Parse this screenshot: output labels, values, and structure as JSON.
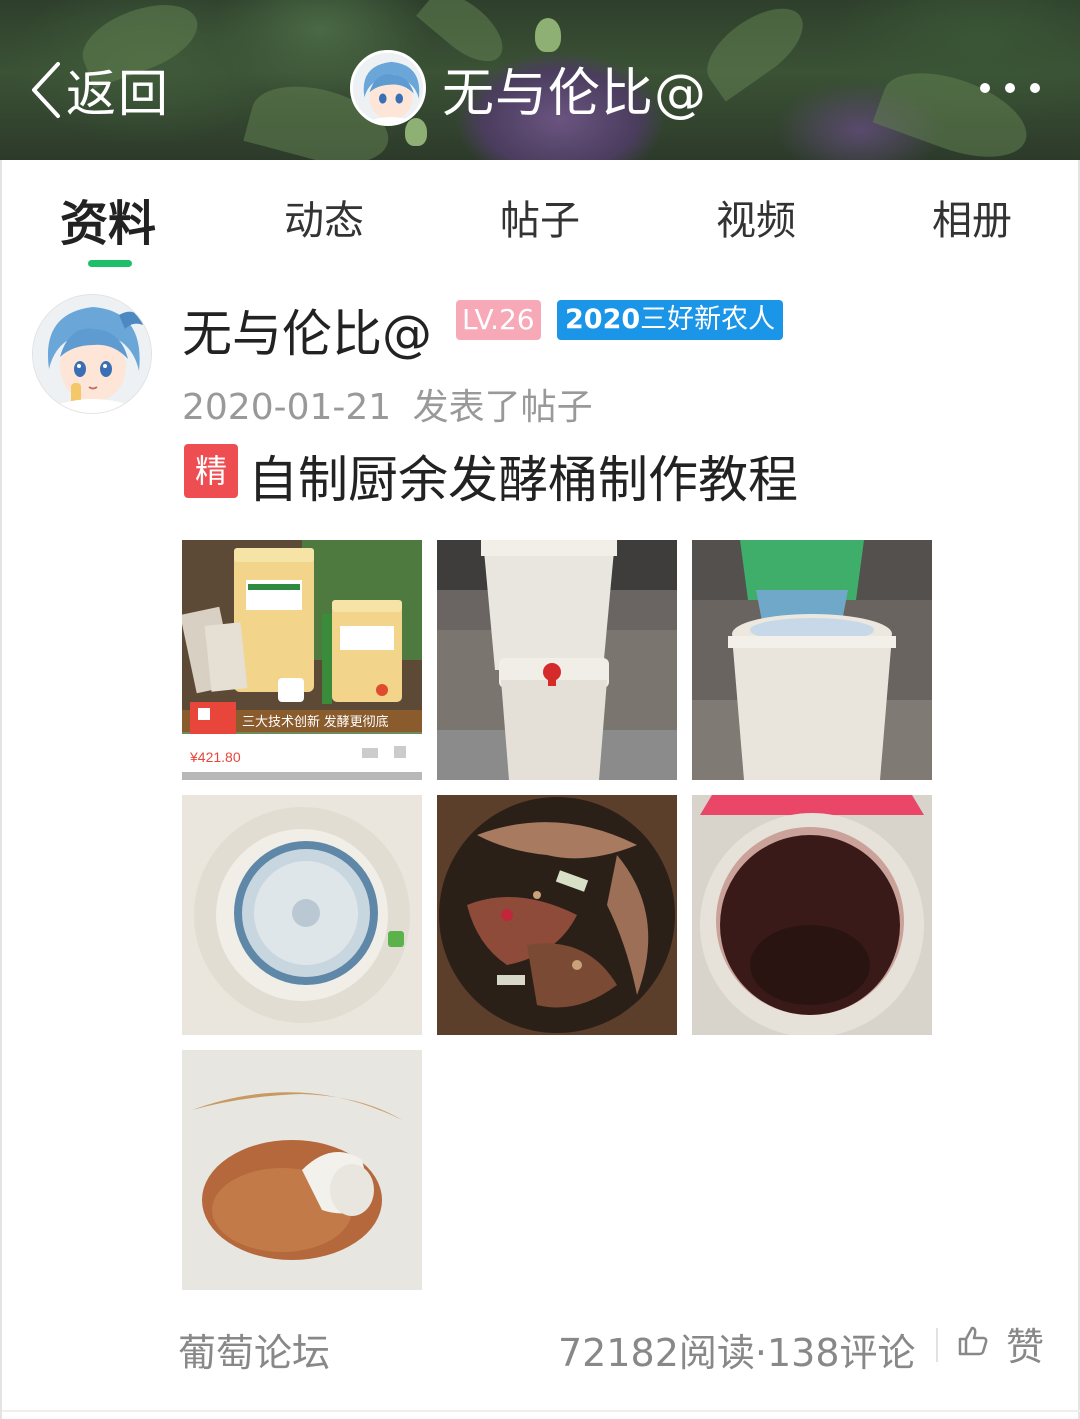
{
  "header": {
    "back_label": "返回",
    "title": "无与伦比@",
    "more_icon": "more-horizontal-icon",
    "text_color": "#ffffff"
  },
  "tabs": [
    {
      "label": "资料",
      "active": true
    },
    {
      "label": "动态",
      "active": false
    },
    {
      "label": "帖子",
      "active": false
    },
    {
      "label": "视频",
      "active": false
    },
    {
      "label": "相册",
      "active": false
    }
  ],
  "accent_color": "#1fbf6a",
  "post": {
    "author": "无与伦比@",
    "level_badge": "LV.26",
    "title_badge": {
      "year": "2020",
      "text": "三好新农人"
    },
    "date": "2020-01-21",
    "action": "发表了帖子",
    "essence_tag": "精",
    "title": "自制厨余发酵桶制作教程",
    "photo_count": 7,
    "forum": "葡萄论坛",
    "stats": "72182阅读·138评论",
    "like_label": "赞",
    "photo1_texts": {
      "banner": "三大技术创新 发酵更彻底",
      "price": "¥421.80"
    }
  },
  "colors": {
    "level_badge_bg": "#f7a9b8",
    "title_badge_bg": "#1a95e8",
    "essence_bg": "#ee4e52",
    "muted_text": "#999999"
  }
}
